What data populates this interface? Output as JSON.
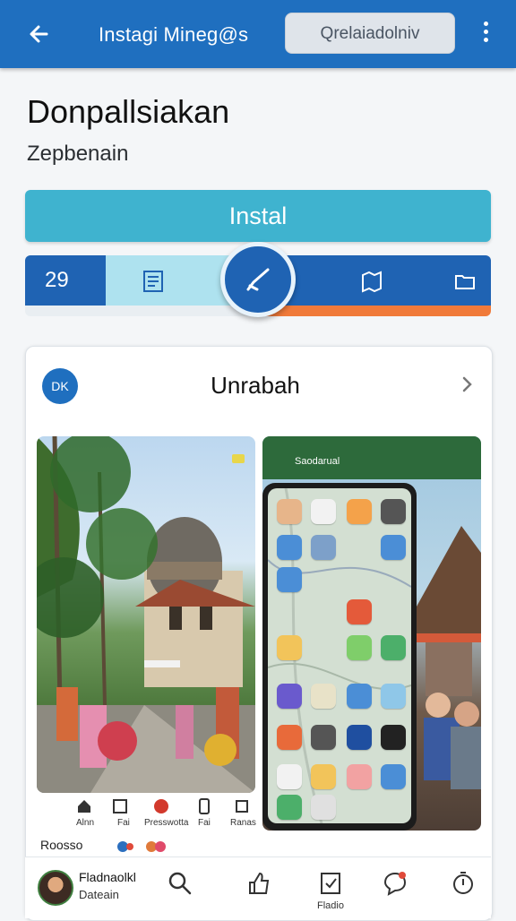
{
  "appbar": {
    "title": "Instagi Mineg@s",
    "pill_label": "Qrelaiadolniv",
    "back_icon": "arrow-left-icon",
    "menu_icon": "kebab-menu-icon"
  },
  "header": {
    "title": "Donpallsiakan",
    "subtitle": "Zepbenain"
  },
  "install_label": "Instal",
  "statbar": {
    "count": "29",
    "icons": [
      "document-icon",
      "edit-pen-icon",
      "map-icon",
      "folder-icon"
    ]
  },
  "card": {
    "badge": "DK",
    "title": "Unrabah",
    "shot2_label": "Saodarual",
    "captions": [
      "Alnn",
      "Fai",
      "Presswotta",
      "Fai",
      "Ranas"
    ],
    "footer_label": "Roosso"
  },
  "bottomnav": {
    "name": "Fladnaolkl",
    "sub": "Dateain",
    "active_label": "Fladio"
  },
  "colors": {
    "appbar": "#1f6fbf",
    "install": "#3fb3cf",
    "accent_blue": "#1f63b3",
    "accent_orange": "#f07a3a"
  }
}
